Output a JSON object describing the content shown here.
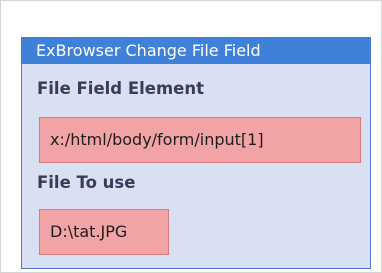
{
  "activity": {
    "title": "ExBrowser Change File Field"
  },
  "properties": [
    {
      "label": "File Field Element",
      "value": "x:/html/body/form/input[1]"
    },
    {
      "label": "File To use",
      "value": "D:\\tat.JPG"
    }
  ],
  "colors": {
    "header_bg": "#3f80d9",
    "panel_bg": "#d9e0f2",
    "field_bg": "#f2a3a5",
    "field_border": "#d67a7c"
  }
}
